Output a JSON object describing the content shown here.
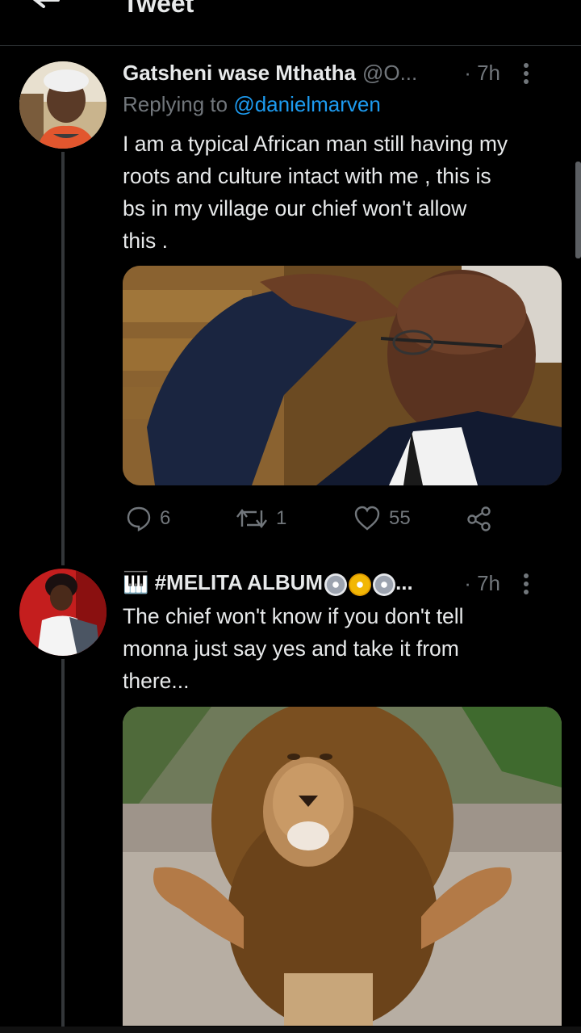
{
  "header": {
    "title": "Tweet"
  },
  "tweets": [
    {
      "name": "Gatsheni wase Mthatha",
      "handle": "@O...",
      "time": "· 7h",
      "replying_prefix": "Replying to ",
      "replying_to": "@danielmarven",
      "text": "I am a typical African man still having my\nroots and culture  intact with me , this is\nbs in my village our chief won't allow\nthis .",
      "actions": {
        "replies": "6",
        "retweets": "1",
        "likes": "55"
      }
    },
    {
      "name_prefix": "🎹 #MELITA ALBUM",
      "name_suffix": "...",
      "time": "· 7h",
      "text": "The chief won't know if you don't tell\nmonna just say yes and take it from\nthere..."
    }
  ],
  "colors": {
    "background": "#000000",
    "text": "#e7e9ea",
    "secondary": "#71767b",
    "link": "#1d9bf0"
  }
}
